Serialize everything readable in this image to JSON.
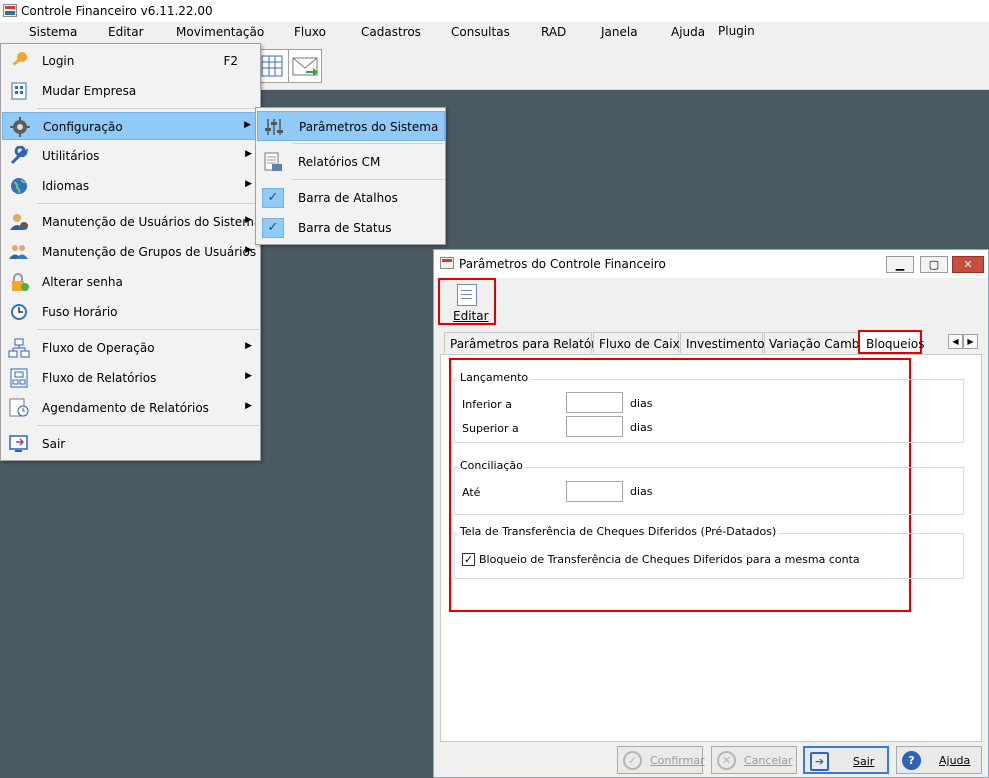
{
  "app": {
    "title": "Controle Financeiro v6.11.22.00"
  },
  "menubar": {
    "items": [
      "Sistema",
      "Editar",
      "Movimentação",
      "Fluxo",
      "Cadastros",
      "Consultas",
      "RAD",
      "Janela",
      "Ajuda",
      "Plugin"
    ]
  },
  "sistema_menu": {
    "items": [
      {
        "label": "Login",
        "shortcut": "F2",
        "icon": "key-icon"
      },
      {
        "label": "Mudar Empresa",
        "icon": "building-icon"
      },
      {
        "label": "Configuração",
        "icon": "gear-icon",
        "submenu": true,
        "highlighted": true
      },
      {
        "label": "Utilitários",
        "icon": "wrench-icon",
        "submenu": true
      },
      {
        "label": "Idiomas",
        "icon": "globe-icon",
        "submenu": true
      },
      {
        "label": "Manutenção de Usuários do Sistema",
        "icon": "user-icon",
        "submenu": true
      },
      {
        "label": "Manutenção de Grupos de Usuários",
        "icon": "users-icon",
        "submenu": true
      },
      {
        "label": "Alterar senha",
        "icon": "lock-icon"
      },
      {
        "label": "Fuso Horário",
        "icon": "clock-icon"
      },
      {
        "label": "Fluxo de Operação",
        "icon": "flow-icon",
        "submenu": true
      },
      {
        "label": "Fluxo de Relatórios",
        "icon": "report-flow-icon",
        "submenu": true
      },
      {
        "label": "Agendamento de Relatórios",
        "icon": "schedule-icon",
        "submenu": true
      },
      {
        "label": "Sair",
        "icon": "exit-icon"
      }
    ]
  },
  "config_submenu": {
    "items": [
      {
        "label": "Parâmetros do Sistema",
        "icon": "sliders-icon",
        "highlighted": true
      },
      {
        "label": "Relatórios CM",
        "icon": "report-icon"
      },
      {
        "label": "Barra de Atalhos",
        "checked": true
      },
      {
        "label": "Barra de Status",
        "checked": true
      }
    ]
  },
  "dialog": {
    "title": "Parâmetros do Controle Financeiro",
    "editar_label": "Editar",
    "tabs": [
      "Parâmetros para Relatórios",
      "Fluxo de Caixa",
      "Investimentos",
      "Variação Cambial",
      "Bloqueios"
    ],
    "active_tab": "Bloqueios",
    "lancamento": {
      "title": "Lançamento",
      "inferior_label": "Inferior a",
      "inferior_value": "",
      "superior_label": "Superior a",
      "superior_value": "",
      "unit": "dias"
    },
    "conciliacao": {
      "title": "Conciliação",
      "ate_label": "Até",
      "ate_value": "",
      "unit": "dias"
    },
    "transferencia": {
      "title": "Tela de Transferência de Cheques Diferidos (Pré-Datados)",
      "checkbox_label": "Bloqueio de Transferência de Cheques Diferidos para a mesma conta",
      "checked": true
    },
    "buttons": {
      "confirmar": "Confirmar",
      "cancelar": "Cancelar",
      "sair": "Sair",
      "ajuda": "Ajuda"
    }
  },
  "colors": {
    "desktop": "#4b5a61",
    "highlight": "#91c9f7",
    "annotation_red": "#e00000"
  }
}
